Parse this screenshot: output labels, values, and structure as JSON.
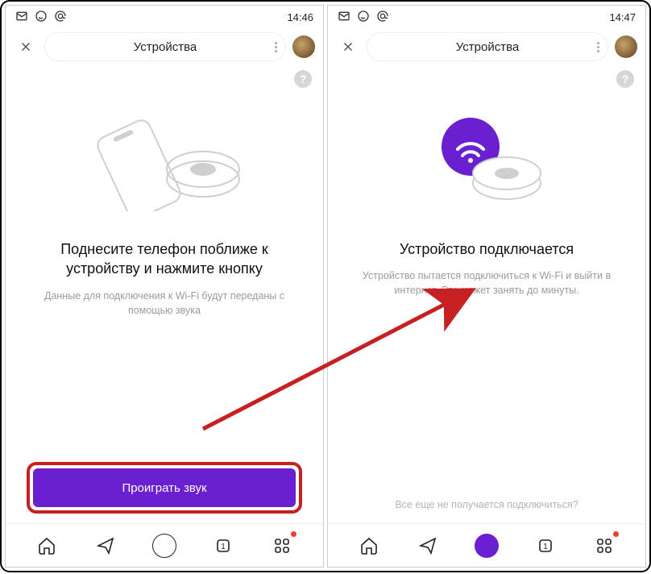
{
  "statusbar": {
    "time_left": "14:46",
    "time_right": "14:47"
  },
  "header": {
    "title": "Устройства"
  },
  "left": {
    "heading": "Поднесите телефон поближе к устройству и нажмите кнопку",
    "sub": "Данные для подключения к Wi-Fi будут переданы с помощью звука",
    "button": "Проиграть звук"
  },
  "right": {
    "heading": "Устройство подключается",
    "sub": "Устройство пытается подключиться к Wi-Fi и выйти в интернет. Это может занять до минуты.",
    "bottom_link": "Все еще не получается подключиться?"
  },
  "help": "?"
}
